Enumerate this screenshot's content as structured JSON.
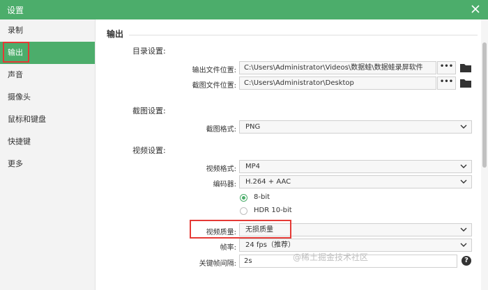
{
  "window": {
    "title": "设置",
    "close_icon": "close-icon"
  },
  "sidebar": {
    "items": [
      {
        "label": "录制"
      },
      {
        "label": "输出"
      },
      {
        "label": "声音"
      },
      {
        "label": "摄像头"
      },
      {
        "label": "鼠标和键盘"
      },
      {
        "label": "快捷键"
      },
      {
        "label": "更多"
      }
    ],
    "active_index": 1
  },
  "main": {
    "section_title": "输出",
    "directory": {
      "title": "目录设置:",
      "output_label": "输出文件位置:",
      "output_value": "C:\\Users\\Administrator\\Videos\\数据蛙\\数据蛙录屏软件",
      "screenshot_label": "截图文件位置:",
      "screenshot_value": "C:\\Users\\Administrator\\Desktop",
      "browse_label": "•••"
    },
    "screenshot": {
      "title": "截图设置:",
      "format_label": "截图格式:",
      "format_value": "PNG"
    },
    "video": {
      "title": "视频设置:",
      "format_label": "视频格式:",
      "format_value": "MP4",
      "encoder_label": "编码器:",
      "encoder_value": "H.264 + AAC",
      "bit_options": [
        "8-bit",
        "HDR 10-bit"
      ],
      "bit_selected": "8-bit",
      "quality_label": "视频质量:",
      "quality_value": "无损质量",
      "framerate_label": "帧率:",
      "framerate_value": "24 fps（推荐）",
      "keyframe_label": "关键帧间隔:",
      "keyframe_value": "2s",
      "help_label": "?"
    }
  },
  "watermark": "@稀土掘金技术社区",
  "colors": {
    "accent": "#4cad6b",
    "highlight_box": "#e53935"
  }
}
